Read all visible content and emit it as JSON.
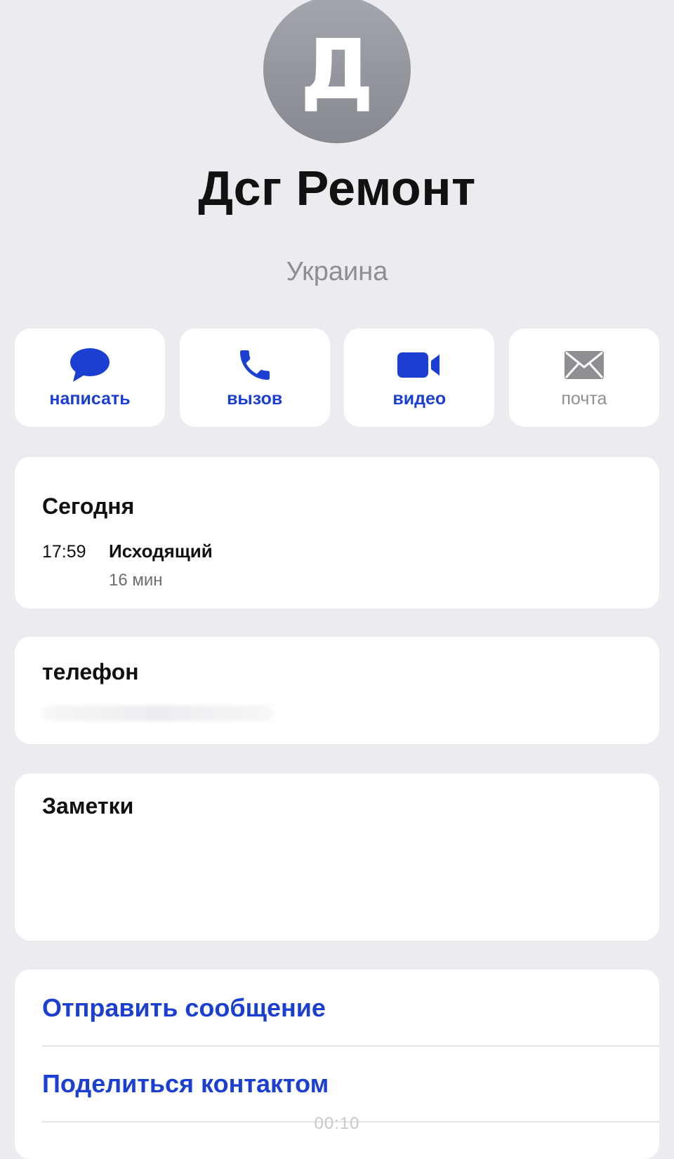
{
  "contact": {
    "initial": "Д",
    "name": "Дсг Ремонт",
    "country": "Украина"
  },
  "actions": [
    {
      "label": "написать",
      "icon": "message-bubble-icon",
      "enabled": true
    },
    {
      "label": "вызов",
      "icon": "phone-icon",
      "enabled": true
    },
    {
      "label": "видео",
      "icon": "video-camera-icon",
      "enabled": true
    },
    {
      "label": "почта",
      "icon": "mail-envelope-icon",
      "enabled": false
    }
  ],
  "recents": {
    "title": "Сегодня",
    "time": "17:59",
    "type": "Исходящий",
    "duration": "16 мин"
  },
  "phone": {
    "label": "телефон"
  },
  "notes": {
    "label": "Заметки"
  },
  "links": {
    "send_message": "Отправить сообщение",
    "share_contact": "Поделиться контактом"
  },
  "overlay": {
    "timer": "00:10"
  },
  "colors": {
    "accent": "#1b3fd1",
    "background": "#ebebf0",
    "secondary_text": "#8e8e93"
  }
}
